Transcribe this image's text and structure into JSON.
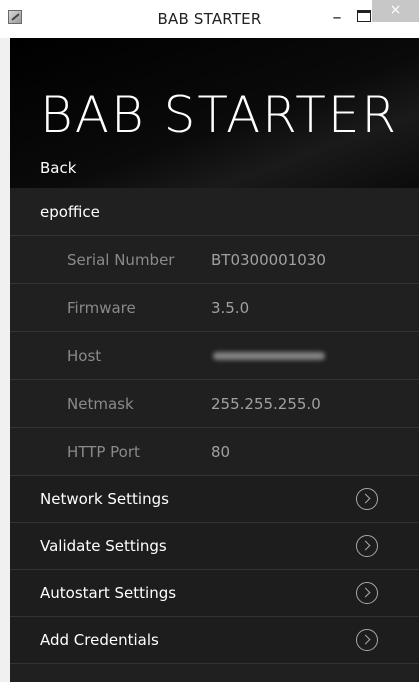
{
  "window": {
    "title": "BAB STARTER",
    "minimize_glyph": "–",
    "close_glyph": "×"
  },
  "header": {
    "title": "BAB STARTER",
    "back_label": "Back"
  },
  "device": {
    "name": "epoffice",
    "fields": [
      {
        "label": "Serial Number",
        "value": "BT0300001030"
      },
      {
        "label": "Firmware",
        "value": "3.5.0"
      },
      {
        "label": "Host",
        "value": "",
        "obscured": true
      },
      {
        "label": "Netmask",
        "value": "255.255.255.0"
      },
      {
        "label": "HTTP Port",
        "value": "80"
      }
    ]
  },
  "menu": [
    {
      "label": "Network Settings",
      "icon": "chevron-right-circle-icon"
    },
    {
      "label": "Validate Settings",
      "icon": "chevron-right-circle-icon"
    },
    {
      "label": "Autostart Settings",
      "icon": "chevron-right-circle-icon"
    },
    {
      "label": "Add Credentials",
      "icon": "chevron-right-circle-icon"
    }
  ],
  "colors": {
    "background": "#202020",
    "header": "#000000",
    "text": "#ffffff",
    "muted_text": "#8a8a8a"
  }
}
